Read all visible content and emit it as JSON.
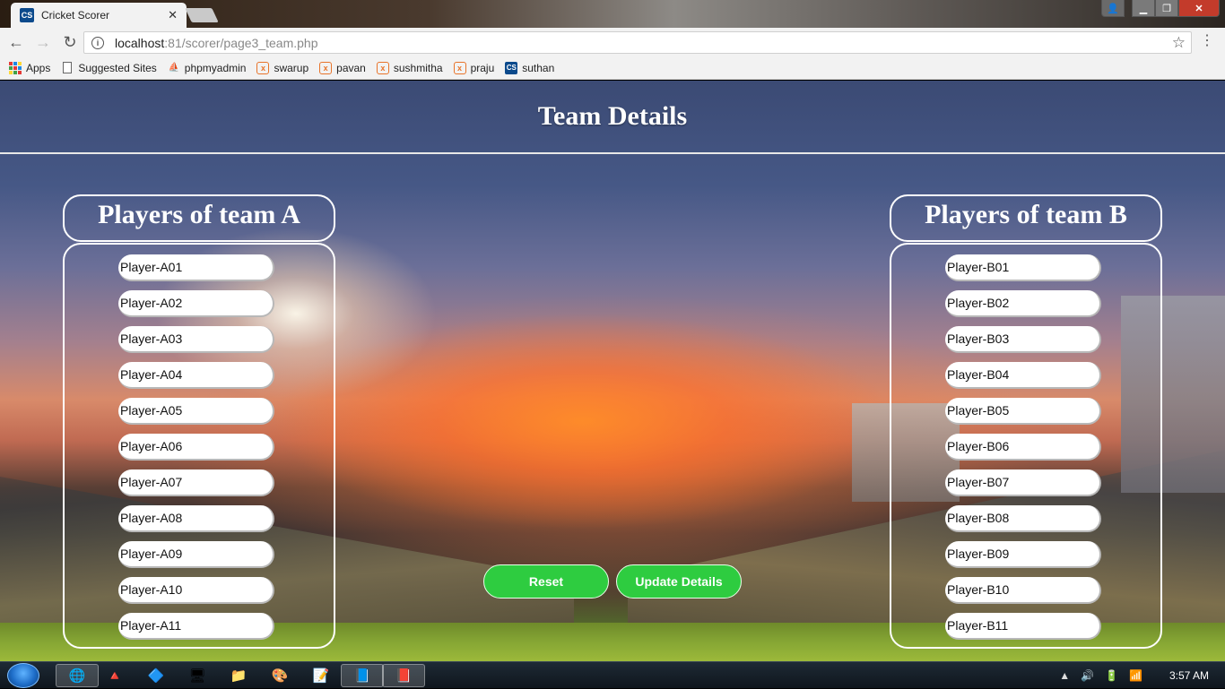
{
  "browser": {
    "tab": {
      "favicon": "CS",
      "title": "Cricket Scorer"
    },
    "url": {
      "host": "localhost",
      "path": ":81/scorer/page3_team.php"
    },
    "bookmarks": [
      {
        "label": "Apps",
        "icon": "apps-grid-icon"
      },
      {
        "label": "Suggested Sites",
        "icon": "page-icon"
      },
      {
        "label": "phpmyadmin",
        "icon": "phpmyadmin-icon"
      },
      {
        "label": "swarup",
        "icon": "xampp-icon"
      },
      {
        "label": "pavan",
        "icon": "xampp-icon"
      },
      {
        "label": "sushmitha",
        "icon": "xampp-icon"
      },
      {
        "label": "praju",
        "icon": "xampp-icon"
      },
      {
        "label": "suthan",
        "icon": "cs-icon"
      }
    ]
  },
  "page": {
    "title": "Team Details",
    "team_a": {
      "heading": "Players of team A",
      "players": [
        "Player-A01",
        "Player-A02",
        "Player-A03",
        "Player-A04",
        "Player-A05",
        "Player-A06",
        "Player-A07",
        "Player-A08",
        "Player-A09",
        "Player-A10",
        "Player-A11"
      ]
    },
    "team_b": {
      "heading": "Players of team B",
      "players": [
        "Player-B01",
        "Player-B02",
        "Player-B03",
        "Player-B04",
        "Player-B05",
        "Player-B06",
        "Player-B07",
        "Player-B08",
        "Player-B09",
        "Player-B10",
        "Player-B11"
      ]
    },
    "buttons": {
      "reset": "Reset",
      "update": "Update Details"
    },
    "colors": {
      "button": "#2ecc40",
      "panel_border": "#ffffff"
    }
  },
  "taskbar": {
    "clock": "3:57 AM"
  }
}
